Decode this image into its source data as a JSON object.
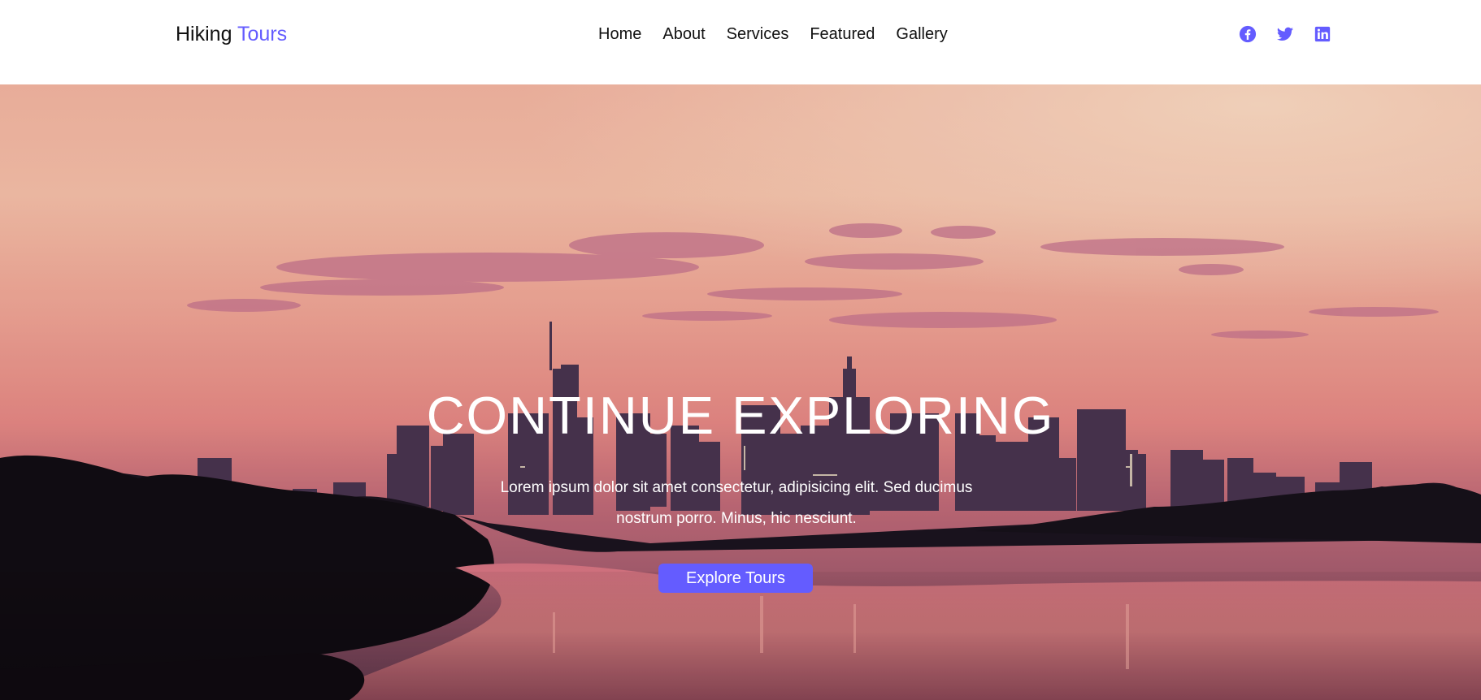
{
  "brand": {
    "part1": "Hiking",
    "part2": "Tours",
    "accent_color": "#645cff"
  },
  "nav": {
    "links": [
      {
        "label": "Home"
      },
      {
        "label": "About"
      },
      {
        "label": "Services"
      },
      {
        "label": "Featured"
      },
      {
        "label": "Gallery"
      }
    ]
  },
  "social": {
    "icons": [
      "facebook-icon",
      "twitter-icon",
      "linkedin-icon"
    ],
    "color": "#645cff"
  },
  "hero": {
    "title": "CONTINUE EXPLORING",
    "text": "Lorem ipsum dolor sit amet consectetur, adipisicing elit. Sed ducimus nostrum porro. Minus, hic nesciunt.",
    "button_label": "Explore Tours",
    "button_color": "#645cff"
  }
}
